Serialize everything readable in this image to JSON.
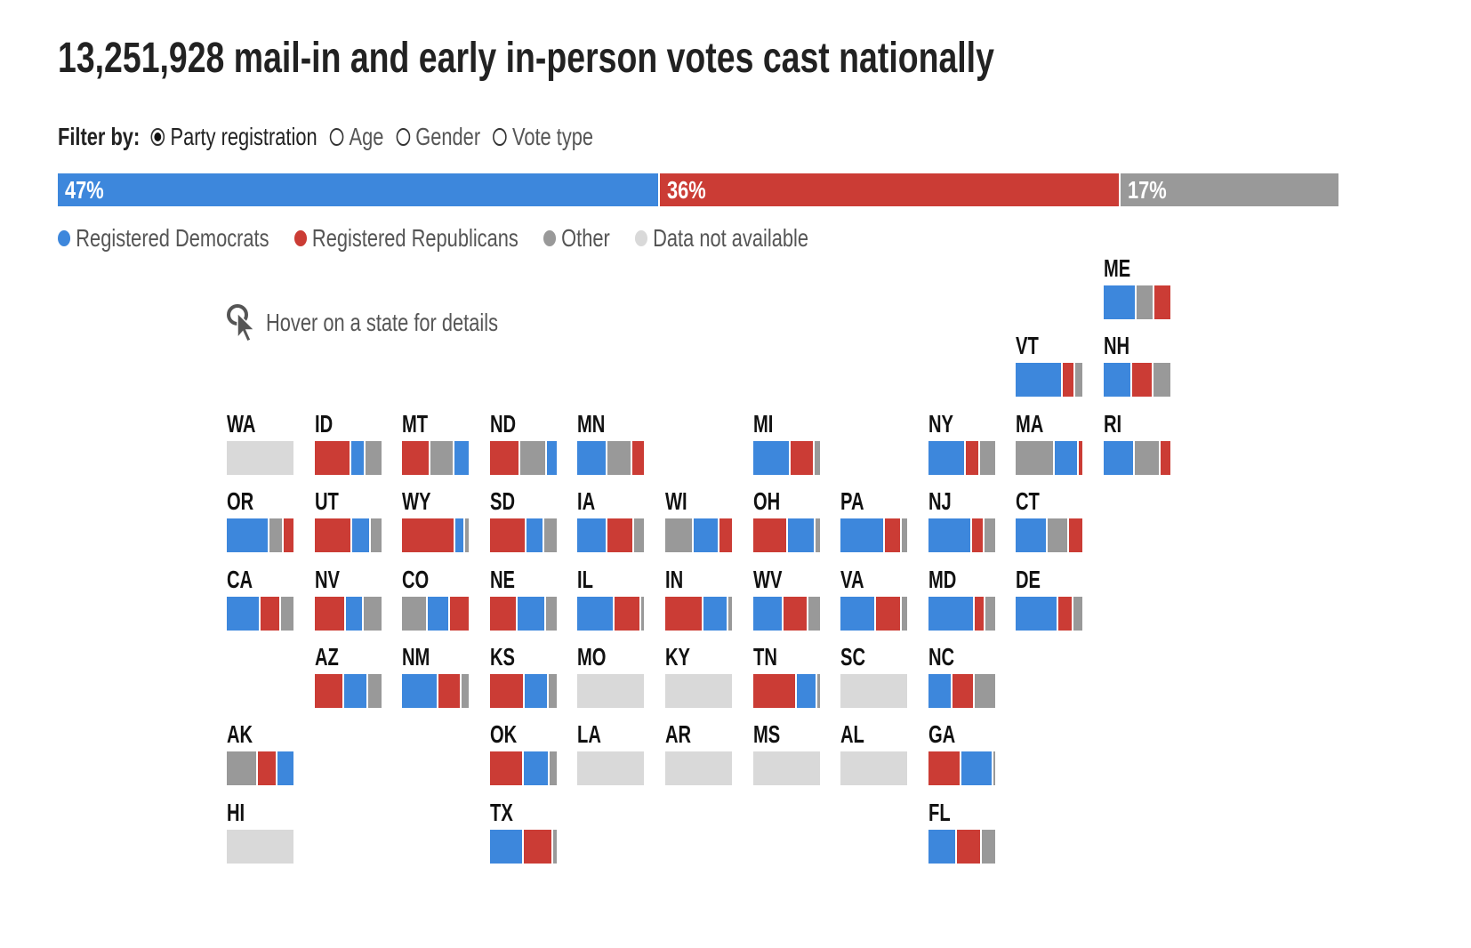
{
  "title": "13,251,928 mail-in and early in-person votes cast nationally",
  "filter": {
    "label": "Filter by:",
    "options": [
      {
        "label": "Party registration",
        "selected": true
      },
      {
        "label": "Age",
        "selected": false
      },
      {
        "label": "Gender",
        "selected": false
      },
      {
        "label": "Vote type",
        "selected": false
      }
    ]
  },
  "colors": {
    "D": "#3d87dc",
    "R": "#cb3c35",
    "O": "#999999",
    "NA": "#d9d9d9"
  },
  "national": [
    {
      "party": "D",
      "pct": 47,
      "label": "47%"
    },
    {
      "party": "R",
      "pct": 36,
      "label": "36%"
    },
    {
      "party": "O",
      "pct": 17,
      "label": "17%"
    }
  ],
  "legend": [
    {
      "key": "D",
      "label": "Registered Democrats"
    },
    {
      "key": "R",
      "label": "Registered Republicans"
    },
    {
      "key": "O",
      "label": "Other"
    },
    {
      "key": "NA",
      "label": "Data not available"
    }
  ],
  "hover_hint": {
    "icon": "cursor-click-icon",
    "text": "Hover on a state for details"
  },
  "chart_data": {
    "type": "bar",
    "subtype": "tile-map stacked 100% bars",
    "unit": "percent of votes cast",
    "states": [
      {
        "state": "ME",
        "segments": [
          [
            "D",
            49
          ],
          [
            "O",
            27
          ],
          [
            "R",
            24
          ]
        ]
      },
      {
        "state": "VT",
        "segments": [
          [
            "D",
            70
          ],
          [
            "R",
            19
          ],
          [
            "O",
            11
          ]
        ]
      },
      {
        "state": "NH",
        "segments": [
          [
            "D",
            42
          ],
          [
            "R",
            33
          ],
          [
            "O",
            25
          ]
        ]
      },
      {
        "state": "WA",
        "segments": null
      },
      {
        "state": "ID",
        "segments": [
          [
            "R",
            55
          ],
          [
            "D",
            22
          ],
          [
            "O",
            23
          ]
        ]
      },
      {
        "state": "MT",
        "segments": [
          [
            "R",
            43
          ],
          [
            "O",
            36
          ],
          [
            "D",
            21
          ]
        ]
      },
      {
        "state": "ND",
        "segments": [
          [
            "R",
            46
          ],
          [
            "O",
            40
          ],
          [
            "D",
            14
          ]
        ]
      },
      {
        "state": "MN",
        "segments": [
          [
            "D",
            45
          ],
          [
            "O",
            37
          ],
          [
            "R",
            18
          ]
        ]
      },
      {
        "state": "MI",
        "segments": [
          [
            "D",
            56
          ],
          [
            "R",
            36
          ],
          [
            "O",
            8
          ]
        ]
      },
      {
        "state": "NY",
        "segments": [
          [
            "D",
            56
          ],
          [
            "R",
            22
          ],
          [
            "O",
            22
          ]
        ]
      },
      {
        "state": "MA",
        "segments": [
          [
            "O",
            58
          ],
          [
            "D",
            36
          ],
          [
            "R",
            6
          ]
        ]
      },
      {
        "state": "RI",
        "segments": [
          [
            "D",
            47
          ],
          [
            "O",
            38
          ],
          [
            "R",
            15
          ]
        ]
      },
      {
        "state": "OR",
        "segments": [
          [
            "D",
            64
          ],
          [
            "O",
            21
          ],
          [
            "R",
            15
          ]
        ]
      },
      {
        "state": "UT",
        "segments": [
          [
            "R",
            57
          ],
          [
            "D",
            27
          ],
          [
            "O",
            16
          ]
        ]
      },
      {
        "state": "WY",
        "segments": [
          [
            "R",
            80
          ],
          [
            "D",
            15
          ],
          [
            "O",
            5
          ]
        ]
      },
      {
        "state": "SD",
        "segments": [
          [
            "R",
            55
          ],
          [
            "D",
            27
          ],
          [
            "O",
            18
          ]
        ]
      },
      {
        "state": "IA",
        "segments": [
          [
            "D",
            45
          ],
          [
            "R",
            40
          ],
          [
            "O",
            15
          ]
        ]
      },
      {
        "state": "WI",
        "segments": [
          [
            "O",
            42
          ],
          [
            "D",
            39
          ],
          [
            "R",
            19
          ]
        ]
      },
      {
        "state": "OH",
        "segments": [
          [
            "R",
            52
          ],
          [
            "D",
            42
          ],
          [
            "O",
            6
          ]
        ]
      },
      {
        "state": "PA",
        "segments": [
          [
            "D",
            67
          ],
          [
            "R",
            25
          ],
          [
            "O",
            8
          ]
        ]
      },
      {
        "state": "NJ",
        "segments": [
          [
            "D",
            65
          ],
          [
            "R",
            19
          ],
          [
            "O",
            16
          ]
        ]
      },
      {
        "state": "CT",
        "segments": [
          [
            "D",
            48
          ],
          [
            "O",
            31
          ],
          [
            "R",
            21
          ]
        ]
      },
      {
        "state": "CA",
        "segments": [
          [
            "D",
            50
          ],
          [
            "R",
            31
          ],
          [
            "O",
            19
          ]
        ]
      },
      {
        "state": "NV",
        "segments": [
          [
            "R",
            47
          ],
          [
            "D",
            27
          ],
          [
            "O",
            26
          ]
        ]
      },
      {
        "state": "CO",
        "segments": [
          [
            "O",
            39
          ],
          [
            "D",
            33
          ],
          [
            "R",
            28
          ]
        ]
      },
      {
        "state": "NE",
        "segments": [
          [
            "R",
            42
          ],
          [
            "D",
            42
          ],
          [
            "O",
            16
          ]
        ]
      },
      {
        "state": "IL",
        "segments": [
          [
            "D",
            56
          ],
          [
            "R",
            39
          ],
          [
            "O",
            5
          ]
        ]
      },
      {
        "state": "IN",
        "segments": [
          [
            "R",
            57
          ],
          [
            "D",
            38
          ],
          [
            "O",
            5
          ]
        ]
      },
      {
        "state": "WV",
        "segments": [
          [
            "D",
            46
          ],
          [
            "R",
            37
          ],
          [
            "O",
            17
          ]
        ]
      },
      {
        "state": "VA",
        "segments": [
          [
            "D",
            53
          ],
          [
            "R",
            39
          ],
          [
            "O",
            8
          ]
        ]
      },
      {
        "state": "MD",
        "segments": [
          [
            "D",
            70
          ],
          [
            "R",
            16
          ],
          [
            "O",
            14
          ]
        ]
      },
      {
        "state": "DE",
        "segments": [
          [
            "D",
            64
          ],
          [
            "R",
            22
          ],
          [
            "O",
            14
          ]
        ]
      },
      {
        "state": "AZ",
        "segments": [
          [
            "R",
            45
          ],
          [
            "D",
            35
          ],
          [
            "O",
            20
          ]
        ]
      },
      {
        "state": "NM",
        "segments": [
          [
            "D",
            54
          ],
          [
            "R",
            35
          ],
          [
            "O",
            11
          ]
        ]
      },
      {
        "state": "KS",
        "segments": [
          [
            "R",
            52
          ],
          [
            "D",
            36
          ],
          [
            "O",
            12
          ]
        ]
      },
      {
        "state": "MO",
        "segments": null
      },
      {
        "state": "KY",
        "segments": null
      },
      {
        "state": "TN",
        "segments": [
          [
            "R",
            66
          ],
          [
            "D",
            31
          ],
          [
            "O",
            3
          ]
        ]
      },
      {
        "state": "SC",
        "segments": null
      },
      {
        "state": "NC",
        "segments": [
          [
            "D",
            36
          ],
          [
            "R",
            34
          ],
          [
            "O",
            30
          ]
        ]
      },
      {
        "state": "AK",
        "segments": [
          [
            "O",
            46
          ],
          [
            "R",
            30
          ],
          [
            "D",
            24
          ]
        ]
      },
      {
        "state": "OK",
        "segments": [
          [
            "R",
            51
          ],
          [
            "D",
            38
          ],
          [
            "O",
            11
          ]
        ]
      },
      {
        "state": "LA",
        "segments": null
      },
      {
        "state": "AR",
        "segments": null
      },
      {
        "state": "MS",
        "segments": null
      },
      {
        "state": "AL",
        "segments": null
      },
      {
        "state": "GA",
        "segments": [
          [
            "R",
            50
          ],
          [
            "D",
            47
          ],
          [
            "O",
            3
          ]
        ]
      },
      {
        "state": "HI",
        "segments": null
      },
      {
        "state": "TX",
        "segments": [
          [
            "D",
            51
          ],
          [
            "R",
            44
          ],
          [
            "O",
            5
          ]
        ]
      },
      {
        "state": "FL",
        "segments": [
          [
            "D",
            43
          ],
          [
            "R",
            37
          ],
          [
            "O",
            20
          ]
        ]
      }
    ]
  }
}
